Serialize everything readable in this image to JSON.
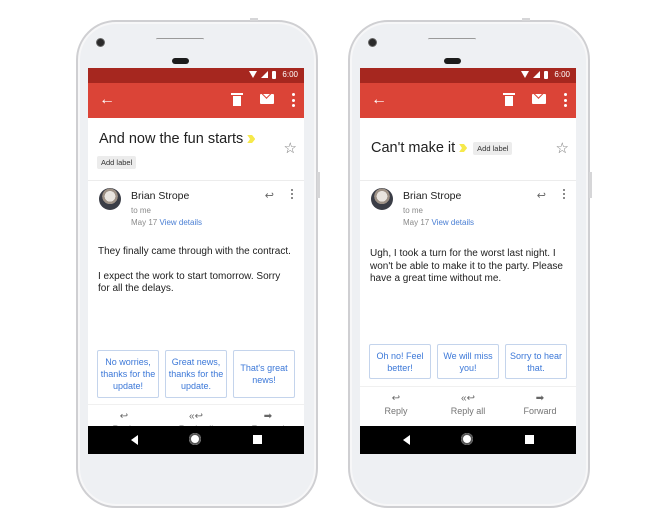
{
  "phones": [
    {
      "status_time": "6:00",
      "subject": "And now the fun starts",
      "add_label": "Add label",
      "sender": "Brian Strope",
      "recipient": "to me",
      "date": "May 17",
      "view_details": "View details",
      "body": [
        "They finally came through with the contract.",
        "I expect the work to start tomorrow. Sorry for all the delays."
      ],
      "smart_replies": [
        "No worries, thanks for the update!",
        "Great news, thanks for the update.",
        "That's great news!"
      ],
      "actions": {
        "reply": "Reply",
        "reply_all": "Reply all",
        "forward": "Forward"
      }
    },
    {
      "status_time": "6:00",
      "subject": "Can't make it",
      "add_label": "Add label",
      "sender": "Brian Strope",
      "recipient": "to me",
      "date": "May 17",
      "view_details": "View details",
      "body": [
        "Ugh, I took a turn for the worst last night. I won't be able to make it to the party. Please have a great time without me."
      ],
      "smart_replies": [
        "Oh no! Feel better!",
        "We will miss you!",
        "Sorry to hear that."
      ],
      "actions": {
        "reply": "Reply",
        "reply_all": "Reply all",
        "forward": "Forward"
      }
    }
  ],
  "icons": {
    "back": "←",
    "star": "☆",
    "reply": "↩",
    "reply_all": "«↩",
    "forward": "➡"
  },
  "colors": {
    "toolbar": "#db4437",
    "statusbar": "#a6271f",
    "link": "#4a7fd4",
    "smart_reply_text": "#3c78d8",
    "importance_marker": "#f6e94b"
  }
}
